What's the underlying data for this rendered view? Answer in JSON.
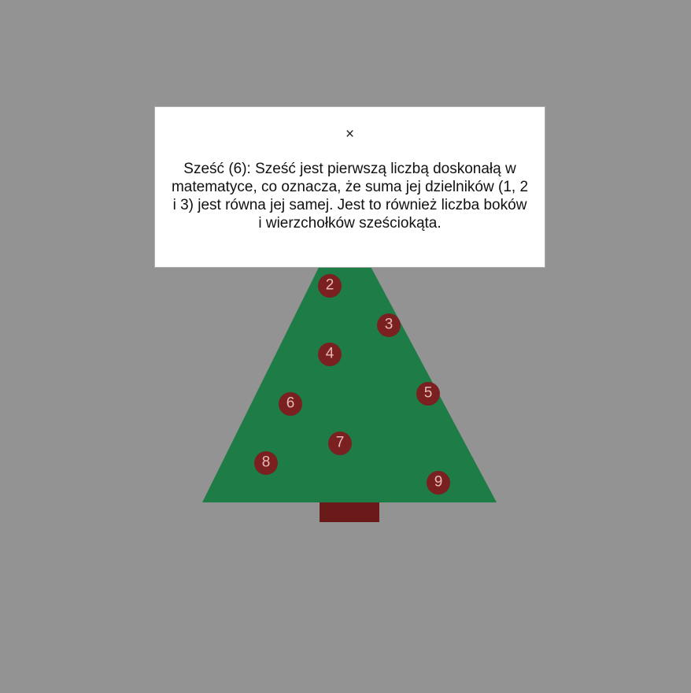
{
  "scene": {
    "colors": {
      "background": "#939393",
      "tree": "#1e7c46",
      "trunk": "#6b1a1a",
      "ornament": "#7a2020",
      "ornament_text": "#e8b9b5"
    },
    "ornaments": [
      {
        "label": "2"
      },
      {
        "label": "3"
      },
      {
        "label": "4"
      },
      {
        "label": "5"
      },
      {
        "label": "6"
      },
      {
        "label": "7"
      },
      {
        "label": "8"
      },
      {
        "label": "9"
      }
    ]
  },
  "modal": {
    "close_icon": "×",
    "text": "Sześć (6): Sześć jest pierwszą liczbą doskonałą w matematyce, co oznacza, że suma jej dzielników (1, 2 i 3) jest równa jej samej. Jest to również liczba boków i wierzchołków sześciokąta."
  }
}
